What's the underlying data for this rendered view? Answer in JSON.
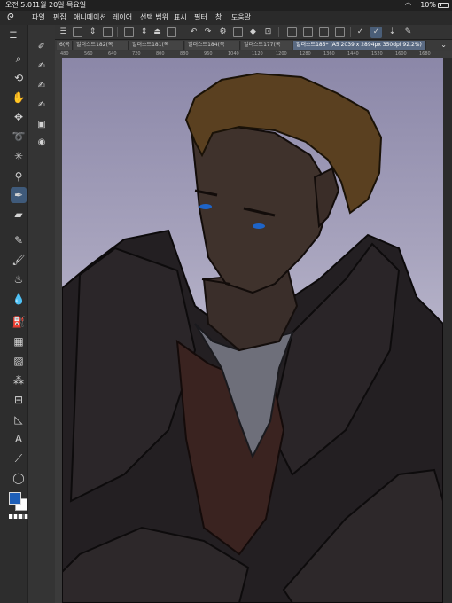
{
  "status_bar": {
    "time": "오전 5:01",
    "date": "1월 20일 목요일",
    "battery": "10%"
  },
  "menu": {
    "items": [
      "파일",
      "편집",
      "애니메이션",
      "레이어",
      "선택 범위",
      "표시",
      "필터",
      "창",
      "도움말"
    ]
  },
  "tabs": {
    "items": [
      {
        "label": "6(복",
        "active": false
      },
      {
        "label": "일러스트182(복",
        "active": false
      },
      {
        "label": "일러스트181(복",
        "active": false
      },
      {
        "label": "일러스트184(복",
        "active": false
      },
      {
        "label": "일러스트177(복",
        "active": false
      },
      {
        "label": "일러스트185* (A5 2039 x 2894px 350dpi 92.2%)",
        "active": true
      }
    ]
  },
  "ruler": {
    "ticks": [
      "480",
      "560",
      "640",
      "720",
      "800",
      "880",
      "960",
      "1040",
      "1120",
      "1200",
      "1280",
      "1360",
      "1440",
      "1520",
      "1600",
      "1680"
    ]
  },
  "colors": {
    "main_color": "#1e5fb8",
    "sub_color": "#ffffff",
    "accent": "#4a5e78"
  }
}
